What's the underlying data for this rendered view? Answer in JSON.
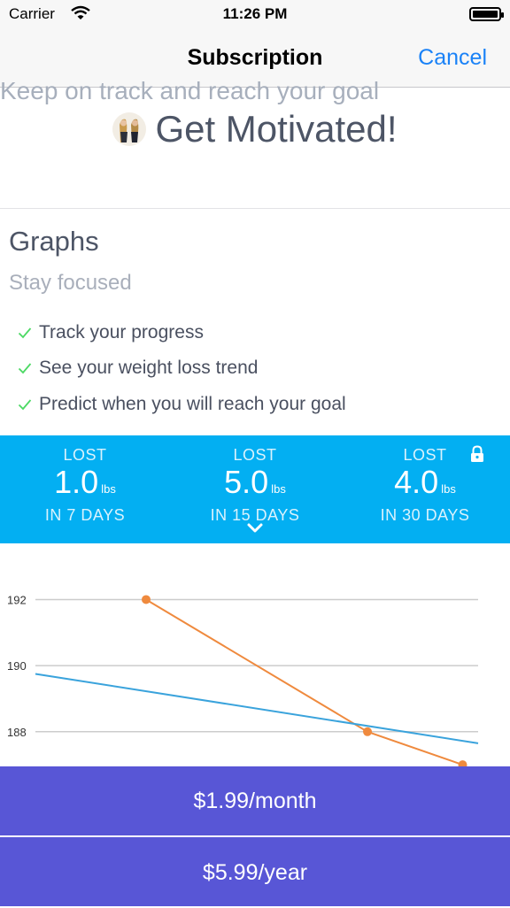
{
  "status_bar": {
    "carrier": "Carrier",
    "time": "11:26 PM",
    "battery_level": 1.0
  },
  "nav": {
    "title": "Subscription",
    "cancel_label": "Cancel"
  },
  "hero": {
    "title": "Get Motivated!",
    "subtitle": "Keep on track and reach your goal"
  },
  "section": {
    "title": "Graphs",
    "subtitle": "Stay focused",
    "features": [
      "Track your progress",
      "See your weight loss trend",
      "Predict when you will reach your goal"
    ]
  },
  "stats": [
    {
      "label": "LOST",
      "value": "1.0",
      "unit": "lbs",
      "period": "IN 7 DAYS"
    },
    {
      "label": "LOST",
      "value": "5.0",
      "unit": "lbs",
      "period": "IN 15 DAYS"
    },
    {
      "label": "LOST",
      "value": "4.0",
      "unit": "lbs",
      "period": "IN 30 DAYS"
    }
  ],
  "chart_data": {
    "type": "line",
    "y_ticks": [
      "192",
      "190",
      "188"
    ],
    "ylim": [
      186.95,
      193.7
    ],
    "series": [
      {
        "color": "#ef8a3e",
        "x": [
          1.0,
          3.0,
          3.86
        ],
        "values": [
          192.0,
          188.0,
          187.0
        ]
      },
      {
        "color": "#3aa3dc",
        "x": [
          0.0,
          4.0
        ],
        "values": [
          189.75,
          187.65
        ]
      }
    ],
    "xlim": [
      0.0,
      4.0
    ],
    "colors": {
      "grid": "#cccccc"
    }
  },
  "plans": [
    {
      "label": "$1.99/month"
    },
    {
      "label": "$5.99/year"
    }
  ],
  "colors": {
    "accent_blue": "#03aff2",
    "button_purple": "#5856d6",
    "link_blue": "#1a82f7",
    "check_green": "#4cd964"
  }
}
